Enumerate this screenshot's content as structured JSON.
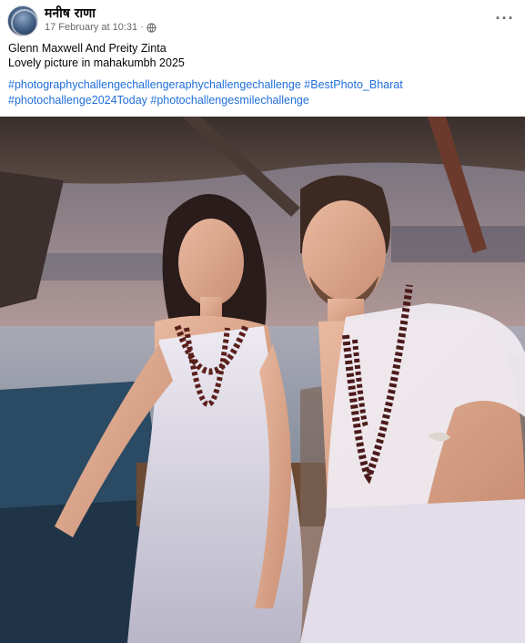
{
  "post": {
    "author": "मनीष राणा",
    "timestamp": "17 February at 10:31",
    "separator": "·",
    "more_label": "···",
    "caption_line1": "Glenn Maxwell And Preity Zinta",
    "caption_line2": "Lovely picture in mahakumbh 2025",
    "hashtags": [
      "#photographychallengechallengeraphychallengechallenge",
      "#BestPhoto_Bharat",
      "#photochallenge2024Today",
      "#photochallengesmilechallenge"
    ]
  },
  "colors": {
    "link": "#216fdb",
    "secondary_text": "#65676b",
    "primary_text": "#050505"
  },
  "icons": [
    "globe-icon",
    "more-options-icon"
  ]
}
